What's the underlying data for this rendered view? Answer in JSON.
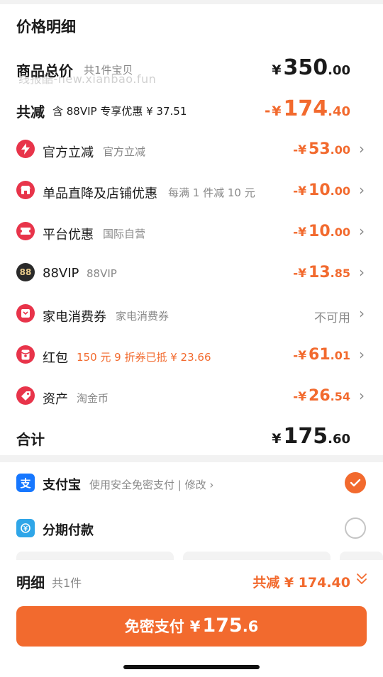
{
  "title": "价格明细",
  "watermark": "线报酷-new.xianbao.fun",
  "total_price": {
    "label": "商品总价",
    "sub": "共1件宝贝",
    "yen": "¥",
    "int": "350",
    "dec": ".00"
  },
  "total_discount": {
    "label": "共减",
    "sub": "含 88VIP 专享优惠 ¥ 37.51",
    "sign": "-",
    "yen": "¥",
    "int": "174",
    "dec": ".40"
  },
  "discounts": [
    {
      "name": "官方立减",
      "desc": "官方立减",
      "sign": "-",
      "yen": "¥",
      "int": "53",
      "dec": ".00",
      "icon": "lightning-icon",
      "color": "#e8344a"
    },
    {
      "name": "单品直降及店铺优惠",
      "desc": "每满 1 件减 10 元",
      "sign": "-",
      "yen": "¥",
      "int": "10",
      "dec": ".00",
      "icon": "shop-icon",
      "color": "#e8344a"
    },
    {
      "name": "平台优惠",
      "desc": "国际自营",
      "sign": "-",
      "yen": "¥",
      "int": "10",
      "dec": ".00",
      "icon": "ticket-icon",
      "color": "#e8344a"
    },
    {
      "name": "88VIP",
      "desc": "88VIP",
      "sign": "-",
      "yen": "¥",
      "int": "13",
      "dec": ".85",
      "icon": "vip-88-icon",
      "color": "#2a2a2a",
      "icon_text": "88"
    },
    {
      "name": "家电消费券",
      "desc": "家电消费券",
      "na": "不可用",
      "icon": "coupon-icon",
      "color": "#e8344a"
    },
    {
      "name": "红包",
      "desc": "150 元 9 折券已抵 ¥ 23.66",
      "sign": "-",
      "yen": "¥",
      "int": "61",
      "dec": ".01",
      "icon": "red-packet-icon",
      "color": "#e8344a",
      "desc_color": "#f26a2e"
    },
    {
      "name": "资产",
      "desc": "淘金币",
      "sign": "-",
      "yen": "¥",
      "int": "26",
      "dec": ".54",
      "icon": "tag-icon",
      "color": "#e8344a"
    }
  ],
  "subtotal": {
    "label": "合计",
    "yen": "¥",
    "int": "175",
    "dec": ".60"
  },
  "payment": {
    "alipay": {
      "name": "支付宝",
      "desc": "使用安全免密支付 | 修改 ›",
      "icon": "alipay-icon",
      "color": "#1677ff"
    },
    "installment": {
      "name": "分期付款",
      "icon": "installment-icon",
      "color": "#2fa6e8"
    }
  },
  "footer": {
    "label": "明细",
    "count": "共1件",
    "total": "共减 ¥ 174.40"
  },
  "pay_button": {
    "text": "免密支付",
    "yen": "¥",
    "int": "175",
    "dec": ".6"
  },
  "colors": {
    "accent": "#f26a2e",
    "danger_icon": "#e8344a"
  }
}
